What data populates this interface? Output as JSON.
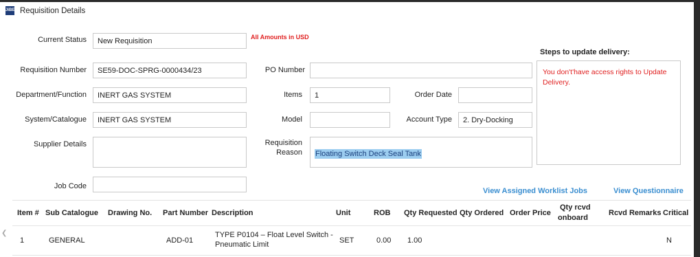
{
  "window": {
    "title": "Requisition Details",
    "icon": "app-logo-icon"
  },
  "note": "All Amounts in USD",
  "fields": {
    "current_status": {
      "label": "Current Status",
      "value": "New Requisition"
    },
    "requisition_number": {
      "label": "Requisition Number",
      "value": "SE59-DOC-SPRG-0000434/23"
    },
    "department": {
      "label": "Department/Function",
      "value": "INERT GAS SYSTEM"
    },
    "system_catalogue": {
      "label": "System/Catalogue",
      "value": "INERT GAS SYSTEM"
    },
    "supplier_details": {
      "label": "Supplier Details",
      "value": ""
    },
    "job_code": {
      "label": "Job Code",
      "value": ""
    },
    "po_number": {
      "label": "PO Number",
      "value": ""
    },
    "items": {
      "label": "Items",
      "value": "1"
    },
    "order_date": {
      "label": "Order Date",
      "value": ""
    },
    "model": {
      "label": "Model",
      "value": ""
    },
    "account_type": {
      "label": "Account Type",
      "value": "2. Dry-Docking"
    },
    "requisition_reason": {
      "label_line1": "Requisition",
      "label_line2": "Reason",
      "value": "Floating Switch Deck Seal Tank"
    }
  },
  "steps": {
    "title": "Steps to update delivery:",
    "message": "You don't'have access rights to Update Delivery."
  },
  "links": {
    "worklist": "View Assigned Worklist Jobs",
    "questionnaire": "View Questionnaire"
  },
  "table": {
    "headers": {
      "item": "Item #",
      "sub_catalogue": "Sub Catalogue",
      "drawing_no": "Drawing No.",
      "part_number": "Part Number",
      "description": "Description",
      "unit": "Unit",
      "rob": "ROB",
      "qty_requested": "Qty Requested",
      "qty_ordered": "Qty Ordered",
      "order_price": "Order Price",
      "qty_rcvd_line1": "Qty rcvd",
      "qty_rcvd_line2": "onboard",
      "rcvd_remarks": "Rcvd Remarks",
      "critical": "Critical"
    },
    "rows": [
      {
        "item": "1",
        "sub_catalogue": "GENERAL",
        "drawing_no": "",
        "part_number": "ADD-01",
        "description_line1": "TYPE P0104 – Float Level Switch -",
        "description_line2": "Pneumatic Limit",
        "unit": "SET",
        "rob": "0.00",
        "qty_requested": "1.00",
        "qty_ordered": "",
        "order_price": "",
        "qty_rcvd": "",
        "rcvd_remarks": "",
        "critical": "N"
      }
    ]
  },
  "colors": {
    "accent": "#3a8ed0",
    "alert": "#e02020",
    "selection": "#9ccdf0"
  }
}
